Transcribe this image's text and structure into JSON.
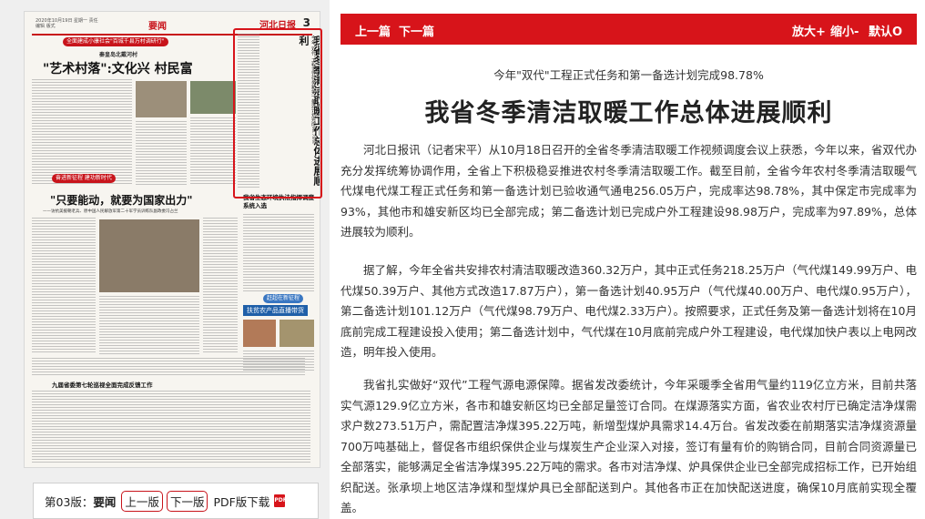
{
  "newspaper": {
    "section": "要闻",
    "page_number": "3",
    "masthead": "河北日报",
    "date_line": "2020年10月19日 星期一 责任编辑 版式",
    "banner1": "全面建成小康社会\"百城千县万村调研行\"",
    "sub1": "秦皇岛北戴河村",
    "title1": "\"艺术村落\":文化兴 村民富",
    "vertical_kicker": "今年\"双代\"工程正式任务和第一备选计划完成98.78%",
    "vertical_title": "我省冬季清洁取暖工作总体进展顺利",
    "banner2": "奋进新征程 建功新时代",
    "title2": "\"只要能动，就要为国家出力\"",
    "sub2": "——访抗美援朝老兵、原中国人民解放军第二十军学员训练队副政委冯占兰",
    "title3": "我省生态环境执法指挥调度系统入选",
    "banner3": "赶超在新征程",
    "title4": "扶贫农产品直播带货",
    "footer": "九届省委第七轮巡视全面完成反馈工作",
    "highlight": "当前阅读：我省冬季清洁取暖工作总体进展顺利"
  },
  "page_nav": {
    "label_prefix": "第03版：",
    "label_name": "要闻",
    "prev_label": "上一版",
    "next_label": "下一版",
    "pdf_label": "PDF版下载",
    "pdf_icon": "PDF"
  },
  "toolbar": {
    "prev": "上一篇",
    "next": "下一篇",
    "zoom_in": "放大+",
    "zoom_out": "缩小-",
    "default": "默认O"
  },
  "article": {
    "subtitle": "今年\"双代\"工程正式任务和第一备选计划完成98.78%",
    "headline": "我省冬季清洁取暖工作总体进展顺利",
    "paragraphs": [
      "河北日报讯（记者宋平）从10月18日召开的全省冬季清洁取暖工作视频调度会议上获悉，今年以来，省双代办充分发挥统筹协调作用，全省上下积极稳妥推进农村冬季清洁取暖工作。截至目前，全省今年农村冬季清洁取暖气代煤电代煤工程正式任务和第一备选计划已验收通气通电256.05万户，完成率达98.78%，其中保定市完成率为93%，其他市和雄安新区均已全部完成；第二备选计划已完成户外工程建设98.98万户，完成率为97.89%，总体进展较为顺利。",
      "据了解，今年全省共安排农村清洁取暖改造360.32万户，其中正式任务218.25万户（气代煤149.99万户、电代煤50.39万户、其他方式改造17.87万户），第一备选计划40.95万户（气代煤40.00万户、电代煤0.95万户），第二备选计划101.12万户（气代煤98.79万户、电代煤2.33万户）。按照要求，正式任务及第一备选计划将在10月底前完成工程建设投入使用；第二备选计划中，气代煤在10月底前完成户外工程建设，电代煤加快户表以上电网改造，明年投入使用。",
      "我省扎实做好“双代”工程气源电源保障。据省发改委统计，今年采暖季全省用气量约119亿立方米，目前共落实气源129.9亿立方米，各市和雄安新区均已全部足量签订合同。在煤源落实方面，省农业农村厅已确定洁净煤需求户数273.51万户，需配置洁净煤395.22万吨，新增型煤炉具需求14.4万台。省发改委在前期落实洁净煤资源量700万吨基础上，督促各市组织保供企业与煤炭生产企业深入对接，签订有量有价的购销合同，目前合同资源量已全部落实，能够满足全省洁净煤395.22万吨的需求。各市对洁净煤、炉具保供企业已全部完成招标工作，已开始组织配送。张承坝上地区洁净煤和型煤炉具已全部配送到户。其他各市正在加快配送进度，确保10月底前实现全覆盖。"
    ]
  },
  "colors": {
    "accent": "#d7141a"
  }
}
